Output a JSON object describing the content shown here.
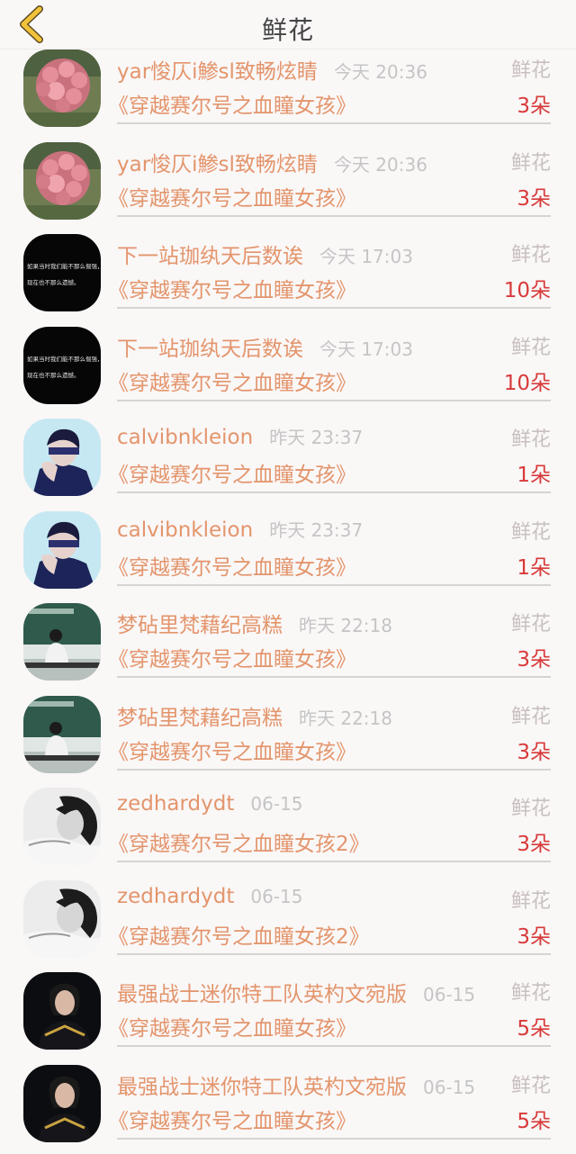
{
  "header": {
    "title": "鲜花",
    "back_icon": "chevron-left-icon",
    "accent": "#f2c23a"
  },
  "colors": {
    "name": "#e3956c",
    "time": "#c5c5c5",
    "count": "#d83a3a"
  },
  "rows": [
    {
      "user": "yar悛仄i鯵sl致畅炫睛",
      "time": "今天 20:36",
      "type": "鲜花",
      "book": "《穿越赛尔号之血瞳女孩》",
      "count": "3朵",
      "avatar": "flower"
    },
    {
      "user": "yar悛仄i鯵sl致畅炫睛",
      "time": "今天 20:36",
      "type": "鲜花",
      "book": "《穿越赛尔号之血瞳女孩》",
      "count": "3朵",
      "avatar": "flower"
    },
    {
      "user": "下一站珈纨天后数诶",
      "time": "今天 17:03",
      "type": "鲜花",
      "book": "《穿越赛尔号之血瞳女孩》",
      "count": "10朵",
      "avatar": "text"
    },
    {
      "user": "下一站珈纨天后数诶",
      "time": "今天 17:03",
      "type": "鲜花",
      "book": "《穿越赛尔号之血瞳女孩》",
      "count": "10朵",
      "avatar": "text"
    },
    {
      "user": "calvibnkleion",
      "time": "昨天 23:37",
      "type": "鲜花",
      "book": "《穿越赛尔号之血瞳女孩》",
      "count": "1朵",
      "avatar": "boy"
    },
    {
      "user": "calvibnkleion",
      "time": "昨天 23:37",
      "type": "鲜花",
      "book": "《穿越赛尔号之血瞳女孩》",
      "count": "1朵",
      "avatar": "boy"
    },
    {
      "user": "梦砧里梵藉纪高糕",
      "time": "昨天 22:18",
      "type": "鲜花",
      "book": "《穿越赛尔号之血瞳女孩》",
      "count": "3朵",
      "avatar": "classroom"
    },
    {
      "user": "梦砧里梵藉纪高糕",
      "time": "昨天 22:18",
      "type": "鲜花",
      "book": "《穿越赛尔号之血瞳女孩》",
      "count": "3朵",
      "avatar": "classroom"
    },
    {
      "user": "zedhardydt",
      "time": "06-15",
      "type": "鲜花",
      "book": "《穿越赛尔号之血瞳女孩2》",
      "count": "3朵",
      "avatar": "bw"
    },
    {
      "user": "zedhardydt",
      "time": "06-15",
      "type": "鲜花",
      "book": "《穿越赛尔号之血瞳女孩2》",
      "count": "3朵",
      "avatar": "bw"
    },
    {
      "user": "最强战士迷你特工队英杓文宛版",
      "time": "06-15",
      "type": "鲜花",
      "book": "《穿越赛尔号之血瞳女孩》",
      "count": "5朵",
      "avatar": "dark"
    },
    {
      "user": "最强战士迷你特工队英杓文宛版",
      "time": "06-15",
      "type": "鲜花",
      "book": "《穿越赛尔号之血瞳女孩》",
      "count": "5朵",
      "avatar": "dark"
    }
  ],
  "avatar_texts": {
    "line1": "如果当时我们能不那么倔强，",
    "line2": "现在也不那么遗憾。"
  }
}
